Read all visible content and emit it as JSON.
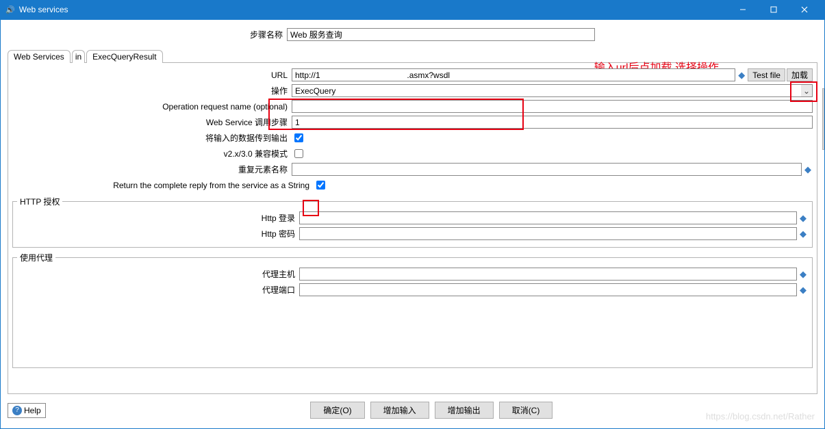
{
  "window": {
    "title": "Web services"
  },
  "stepname": {
    "label": "步骤名称",
    "value": "Web 服务查询"
  },
  "tabs": {
    "t1": "Web Services",
    "t2": "in",
    "t3": "ExecQueryResult"
  },
  "annotation": "输入url后点加载 选择操作",
  "fields": {
    "url": {
      "label": "URL",
      "value": "http://1                                      .asmx?wsdl",
      "testfile": "Test file",
      "load": "加载"
    },
    "op": {
      "label": "操作",
      "value": "ExecQuery"
    },
    "oprn": {
      "label": "Operation request name (optional)",
      "value": ""
    },
    "steps": {
      "label": "Web Service 调用步骤",
      "value": "1"
    },
    "pass": {
      "label": "将输入的数据传到输出"
    },
    "compat": {
      "label": "v2.x/3.0 兼容模式"
    },
    "repeat": {
      "label": "重复元素名称",
      "value": ""
    },
    "retstr": {
      "label": "Return the complete reply from the service as a String"
    }
  },
  "httpauth": {
    "legend": "HTTP 授权",
    "login": {
      "label": "Http 登录",
      "value": ""
    },
    "pwd": {
      "label": "Http 密码",
      "value": ""
    }
  },
  "proxy": {
    "legend": "使用代理",
    "host": {
      "label": "代理主机",
      "value": ""
    },
    "port": {
      "label": "代理端口",
      "value": ""
    }
  },
  "footer": {
    "help": "Help",
    "ok": "确定(O)",
    "addin": "增加输入",
    "addout": "增加输出",
    "cancel": "取消(C)"
  },
  "watermark": "https://blog.csdn.net/Rather"
}
